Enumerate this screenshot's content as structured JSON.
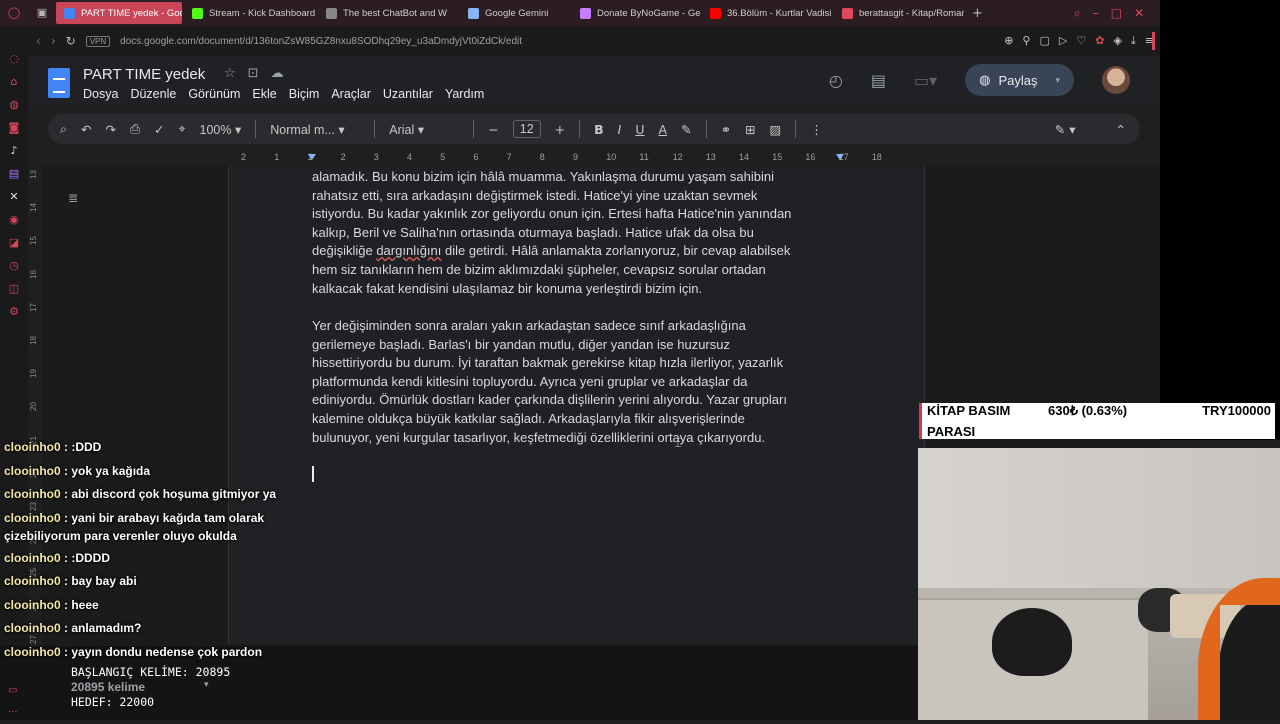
{
  "browser": {
    "tabs": [
      {
        "label": "PART TIME yedek - Goog",
        "active": true,
        "favicon_color": "#4285f4"
      },
      {
        "label": "Stream - Kick Dashboard",
        "active": false,
        "favicon_color": "#53fc18"
      },
      {
        "label": "The best ChatBot and W",
        "active": false,
        "favicon_color": "#888888"
      },
      {
        "label": "Google Gemini",
        "active": false,
        "favicon_color": "#8ab4f8"
      },
      {
        "label": "Donate ByNoGame - Geli",
        "active": false,
        "favicon_color": "#c77dff"
      },
      {
        "label": "36.Bölüm - Kurtlar Vadisi",
        "active": false,
        "favicon_color": "#ff0000"
      },
      {
        "label": "berattasgit - Kitap/Roman",
        "active": false,
        "favicon_color": "#e2485c"
      }
    ],
    "url": "docs.google.com/document/d/136tonZsW85GZ8nxu8SODhq29ey_u3aDmdyjVt0iZdCk/edit",
    "vpn_label": "VPN",
    "accent": "#d8455a"
  },
  "docs": {
    "title": "PART TIME  yedek",
    "menu": [
      "Dosya",
      "Düzenle",
      "Görünüm",
      "Ekle",
      "Biçim",
      "Araçlar",
      "Uzantılar",
      "Yardım"
    ],
    "share_label": "Paylaş",
    "toolbar": {
      "zoom": "100%",
      "style": "Normal m...",
      "font": "Arial",
      "font_size": "12"
    },
    "ruler_labels": [
      "2",
      "1",
      "1",
      "2",
      "3",
      "4",
      "5",
      "6",
      "7",
      "8",
      "9",
      "10",
      "11",
      "12",
      "13",
      "14",
      "15",
      "16",
      "17",
      "18"
    ],
    "vertical_ruler_labels": [
      "13",
      "14",
      "15",
      "16",
      "17",
      "18",
      "19",
      "20",
      "21",
      "22",
      "23",
      "24",
      "25",
      "26",
      "27"
    ],
    "paragraph1": [
      "alamadık. Bu konu bizim için hâlâ muamma. Yakınlaşma durumu yaşam sahibini",
      "rahatsız etti, sıra arkadaşını değiştirmek istedi. Hatice'yi yine uzaktan sevmek",
      "istiyordu. Bu kadar yakınlık zor geliyordu onun için. Ertesi hafta Hatice'nin yanından",
      "kalkıp, Beril ve Saliha'nın ortasında oturmaya başladı. Hatice ufak da olsa bu",
      "hem siz tanıkların hem de bizim aklımızdaki şüpheler, cevapsız sorular ortadan",
      "kalkacak fakat kendisini ulaşılamaz bir konuma yerleştirdi bizim için."
    ],
    "paragraph1_line5": {
      "pre": "değişikliğe ",
      "typo": "dargınlığını",
      "post": " dile getirdi. Hâlâ anlamakta zorlanıyoruz, bir cevap alabilsek"
    },
    "paragraph2": [
      "Yer değişiminden sonra araları yakın arkadaştan sadece sınıf arkadaşlığına",
      "gerilemeye başladı. Barlas'ı bir yandan mutlu, diğer yandan ise huzursuz",
      "hissettiriyordu bu durum. İyi taraftan bakmak gerekirse kitap hızla ilerliyor, yazarlık",
      "platformunda kendi kitlesini topluyordu. Ayrıca yeni gruplar ve arkadaşlar da",
      "ediniyordu. Ömürlük dostları kader çarkında dişlilerin yerini alıyordu. Yazar grupları",
      "kalemine oldukça büyük katkılar sağladı. Arkadaşlarıyla fikir alışverişlerinde",
      "bulunuyor, yeni kurgular tasarlıyor, keşfetmediği özelliklerini ortaya çıkarıyordu."
    ]
  },
  "chat": [
    {
      "user": "clooinho0",
      "text": ":DDD"
    },
    {
      "user": "clooinho0",
      "text": "yok ya kağıda"
    },
    {
      "user": "clooinho0",
      "text": "abi discord çok hoşuma gitmiyor ya"
    },
    {
      "user": "clooinho0",
      "text": "yani bir arabayı kağıda tam olarak",
      "cont": "çizebiliyorum para verenler oluyo okulda"
    },
    {
      "user": "clooinho0",
      "text": ":DDDD"
    },
    {
      "user": "clooinho0",
      "text": "bay bay abi"
    },
    {
      "user": "clooinho0",
      "text": "heee"
    },
    {
      "user": "clooinho0",
      "text": "anlamadım?"
    },
    {
      "user": "clooinho0",
      "text": "yayın dondu nedense çok pardon"
    }
  ],
  "wordcount": {
    "start": "BAŞLANGIÇ KELİME: 20895",
    "count": "20895 kelime",
    "target": "HEDEF: 22000"
  },
  "donation_goal": {
    "title_line1": "KİTAP BASIM",
    "title_line2": "PARASI",
    "amount": "630₺ (0.63%)",
    "target": "TRY100000",
    "accent": "#e0324d"
  }
}
